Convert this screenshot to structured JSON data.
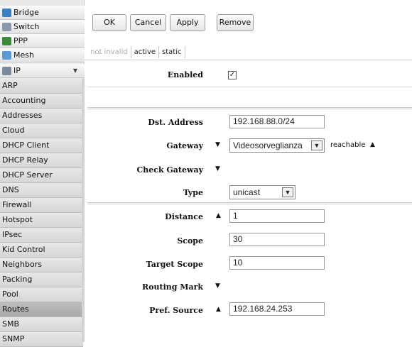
{
  "sidebar": {
    "top_items": [
      {
        "label": "Bridge",
        "icon": "bridge-icon",
        "color": "#3a7fc2"
      },
      {
        "label": "Switch",
        "icon": "switch-icon",
        "color": "#7a8a9a"
      },
      {
        "label": "PPP",
        "icon": "ppp-icon",
        "color": "#3b8a3b"
      },
      {
        "label": "Mesh",
        "icon": "mesh-icon",
        "color": "#5a9ad2"
      },
      {
        "label": "IP",
        "icon": "ip-icon",
        "color": "#7a8a9a"
      }
    ],
    "ip_chevron": "▼",
    "sub_items": [
      "ARP",
      "Accounting",
      "Addresses",
      "Cloud",
      "DHCP Client",
      "DHCP Relay",
      "DHCP Server",
      "DNS",
      "Firewall",
      "Hotspot",
      "IPsec",
      "Kid Control",
      "Neighbors",
      "Packing",
      "Pool",
      "Routes",
      "SMB",
      "SNMP"
    ],
    "active_item": "Routes"
  },
  "toolbar": {
    "ok": "OK",
    "cancel": "Cancel",
    "apply": "Apply",
    "remove": "Remove"
  },
  "tabs": [
    "not invalid",
    "active",
    "static"
  ],
  "form": {
    "enabled_label": "Enabled",
    "enabled_checked": "✓",
    "dst_label": "Dst. Address",
    "dst_value": "192.168.88.0/24",
    "gateway_label": "Gateway",
    "gateway_value": "Videosorveglianza",
    "gateway_status": "reachable",
    "check_gateway_label": "Check Gateway",
    "type_label": "Type",
    "type_value": "unicast",
    "distance_label": "Distance",
    "distance_value": "1",
    "scope_label": "Scope",
    "scope_value": "30",
    "target_scope_label": "Target Scope",
    "target_scope_value": "10",
    "routing_mark_label": "Routing Mark",
    "pref_source_label": "Pref. Source",
    "pref_source_value": "192.168.24.253"
  },
  "glyphs": {
    "down": "▼",
    "up": "▲"
  }
}
